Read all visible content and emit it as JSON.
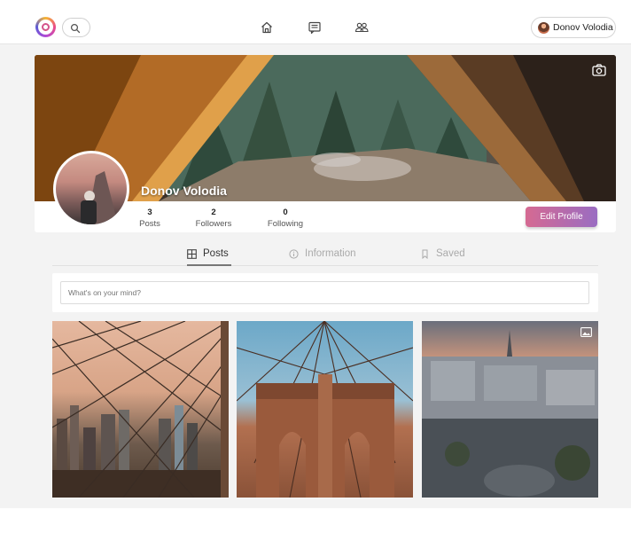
{
  "topbar": {
    "icons": [
      "logo-icon",
      "search-icon",
      "home-icon",
      "feed-icon",
      "friends-icon"
    ],
    "user_name": "Donov Volodia"
  },
  "profile": {
    "name": "Donov Volodia",
    "stats": [
      {
        "value": "3",
        "label": "Posts"
      },
      {
        "value": "2",
        "label": "Followers"
      },
      {
        "value": "0",
        "label": "Following"
      }
    ],
    "edit_button": "Edit Profile"
  },
  "tabs": [
    {
      "label": "Posts",
      "icon": "grid-icon",
      "active": true
    },
    {
      "label": "Information",
      "icon": "info-icon",
      "active": false
    },
    {
      "label": "Saved",
      "icon": "bookmark-icon",
      "active": false
    }
  ],
  "composer": {
    "placeholder": "What's on your mind?"
  },
  "colors": {
    "accent_start": "#d56a92",
    "accent_end": "#9a6cc2",
    "background": "#f3f3f3"
  }
}
